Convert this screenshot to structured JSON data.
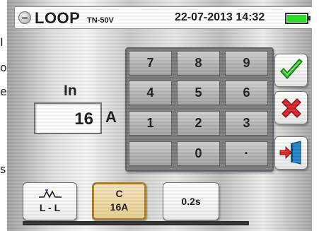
{
  "header": {
    "title": "LOOP",
    "mode": "TN-50V",
    "datetime": "22-07-2013 14:32",
    "battery_level": 1.0
  },
  "side_text": [
    "I",
    "o",
    "e",
    "s"
  ],
  "in_field": {
    "label": "In",
    "value": "16",
    "unit": "A"
  },
  "keypad": {
    "keys": [
      "7",
      "8",
      "9",
      "4",
      "5",
      "6",
      "1",
      "2",
      "3",
      "",
      "0",
      "·"
    ]
  },
  "actions": {
    "confirm_icon": "check-icon",
    "cancel_icon": "x-icon",
    "exit_icon": "exit-door-icon"
  },
  "bottom": {
    "mode_btn": {
      "label": "L - L",
      "icon": "loop-wave-icon"
    },
    "curve_btn": {
      "line1": "C",
      "line2": "16A"
    },
    "time_btn": {
      "label": "0.2s"
    }
  },
  "colors": {
    "battery": "#22e11f",
    "check": "#2fb52a",
    "cancel": "#d9242a",
    "exit_arrow": "#e02828",
    "exit_door": "#1e86c8",
    "selected_border": "#a87d2a"
  }
}
